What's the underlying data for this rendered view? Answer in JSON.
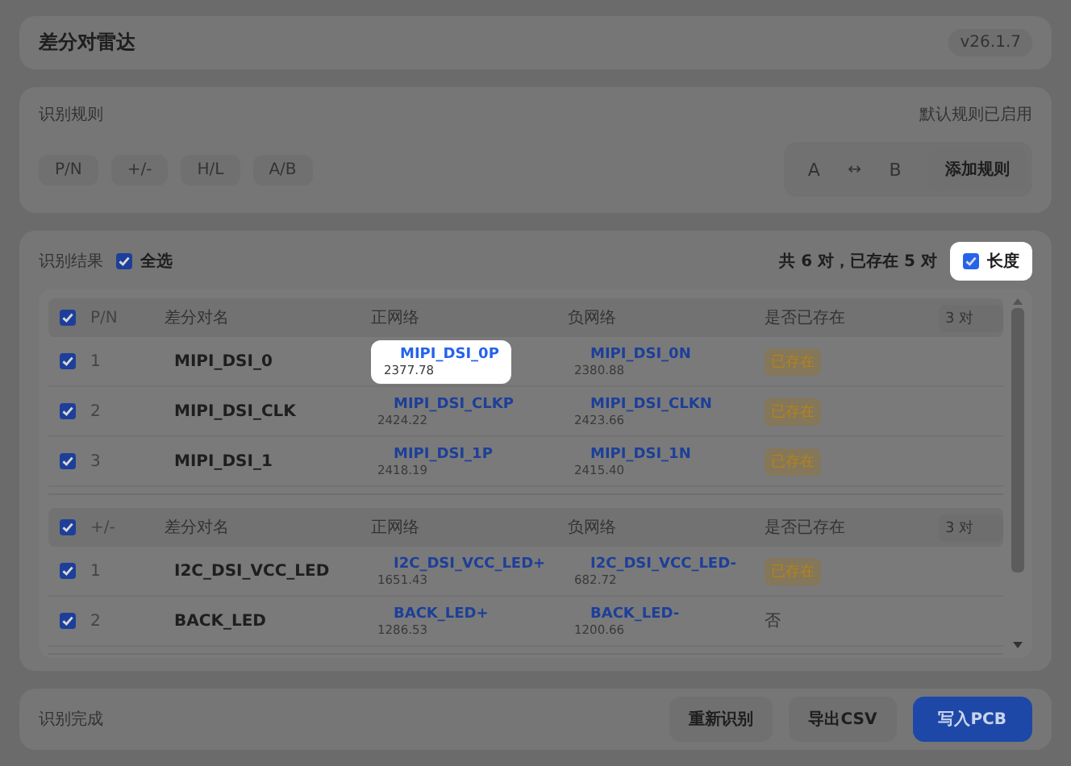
{
  "header": {
    "title": "差分对雷达",
    "version": "v26.1.7"
  },
  "rules": {
    "title": "识别规则",
    "status": "默认规则已启用",
    "presets": [
      "P/N",
      "+/-",
      "H/L",
      "A/B"
    ],
    "custom": {
      "left": "A",
      "arrow": "↔",
      "right": "B",
      "button": "添加规则"
    }
  },
  "results": {
    "title": "识别结果",
    "select_all": {
      "label": "全选",
      "checked": true
    },
    "summary": "共 6 对，已存在 5 对",
    "length": {
      "label": "长度",
      "checked": true,
      "highlighted": true
    },
    "groups": [
      {
        "checked": true,
        "index_header": "P/N",
        "columns": [
          "差分对名",
          "正网络",
          "负网络",
          "是否已存在"
        ],
        "count": "3 对",
        "rows": [
          {
            "checked": true,
            "index": "1",
            "name": "MIPI_DSI_0",
            "pos": {
              "net": "MIPI_DSI_0P",
              "length": "2377.78",
              "highlighted": true
            },
            "neg": {
              "net": "MIPI_DSI_0N",
              "length": "2380.88",
              "highlighted": false
            },
            "exists": true,
            "status": "已存在"
          },
          {
            "checked": true,
            "index": "2",
            "name": "MIPI_DSI_CLK",
            "pos": {
              "net": "MIPI_DSI_CLKP",
              "length": "2424.22",
              "highlighted": false
            },
            "neg": {
              "net": "MIPI_DSI_CLKN",
              "length": "2423.66",
              "highlighted": false
            },
            "exists": true,
            "status": "已存在"
          },
          {
            "checked": true,
            "index": "3",
            "name": "MIPI_DSI_1",
            "pos": {
              "net": "MIPI_DSI_1P",
              "length": "2418.19",
              "highlighted": false
            },
            "neg": {
              "net": "MIPI_DSI_1N",
              "length": "2415.40",
              "highlighted": false
            },
            "exists": true,
            "status": "已存在"
          }
        ]
      },
      {
        "checked": true,
        "index_header": "+/-",
        "columns": [
          "差分对名",
          "正网络",
          "负网络",
          "是否已存在"
        ],
        "count": "3 对",
        "rows": [
          {
            "checked": true,
            "index": "1",
            "name": "I2C_DSI_VCC_LED",
            "pos": {
              "net": "I2C_DSI_VCC_LED+",
              "length": "1651.43",
              "highlighted": false
            },
            "neg": {
              "net": "I2C_DSI_VCC_LED-",
              "length": "682.72",
              "highlighted": false
            },
            "exists": true,
            "status": "已存在"
          },
          {
            "checked": true,
            "index": "2",
            "name": "BACK_LED",
            "pos": {
              "net": "BACK_LED+",
              "length": "1286.53",
              "highlighted": false
            },
            "neg": {
              "net": "BACK_LED-",
              "length": "1200.66",
              "highlighted": false
            },
            "exists": false,
            "status": "否"
          }
        ]
      }
    ]
  },
  "footer": {
    "status": "识别完成",
    "buttons": [
      {
        "label": "重新识别",
        "primary": false
      },
      {
        "label": "导出CSV",
        "primary": false
      },
      {
        "label": "写入PCB",
        "primary": true
      }
    ]
  }
}
